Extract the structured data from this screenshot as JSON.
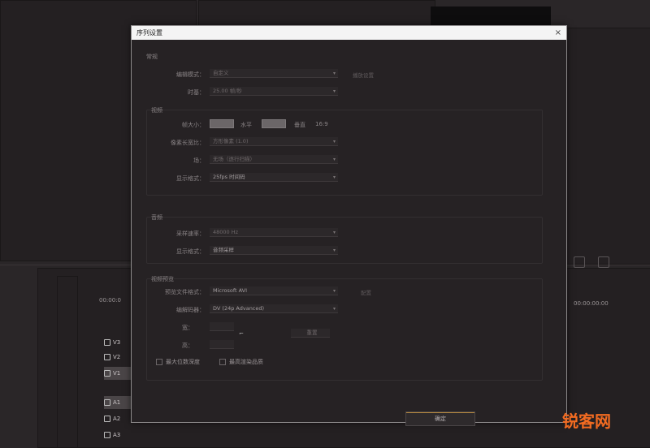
{
  "dialog": {
    "title": "序列设置",
    "close_glyph": "×",
    "general_label": "常规",
    "editing_mode_label": "编辑模式：",
    "editing_mode_value": "自定义",
    "editing_mode_side": "播放设置",
    "timebase_label": "时基：",
    "timebase_value": "25.00 帧/秒",
    "video_label": "视频",
    "frame_size_label": "帧大小：",
    "horizontal_label": "水平",
    "vertical_label": "垂直",
    "aspect_value": "16:9",
    "pixel_aspect_label": "像素长宽比：",
    "pixel_aspect_value": "方形像素 (1.0)",
    "fields_label": "场：",
    "fields_value": "无场（逐行扫描）",
    "display_format_label": "显示格式：",
    "display_format_value": "25fps 时间码",
    "audio_label": "音频",
    "sample_rate_label": "采样速率：",
    "sample_rate_value": "48000 Hz",
    "audio_display_label": "显示格式：",
    "audio_display_value": "音频采样",
    "preview_label": "视频预览",
    "preview_format_label": "预览文件格式：",
    "preview_format_value": "Microsoft AVI",
    "preview_format_side": "配置",
    "codec_label": "编解码器：",
    "codec_value": "DV (24p Advanced)",
    "width_label": "宽：",
    "height_label": "高：",
    "reset_label": "重置",
    "max_bit_depth_label": "最大位数深度",
    "max_render_quality_label": "最高渲染品质",
    "ok_label": "确定"
  },
  "background": {
    "timecode_1": "00:00:0",
    "timecode_2": "00:00:00:00",
    "tracks": [
      "V3",
      "V2",
      "V1",
      "A1",
      "A2",
      "A3"
    ]
  },
  "watermark": "锐客网"
}
